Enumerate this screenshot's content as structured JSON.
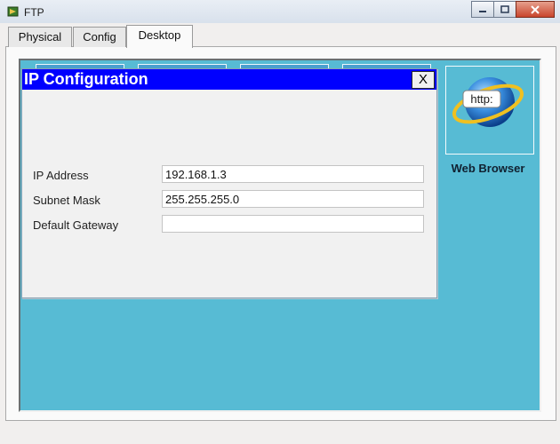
{
  "window": {
    "title": "FTP",
    "minimize_label": "minimize",
    "maximize_label": "maximize",
    "close_label": "close"
  },
  "tabs": [
    {
      "label": "Physical",
      "active": false
    },
    {
      "label": "Config",
      "active": false
    },
    {
      "label": "Desktop",
      "active": true
    }
  ],
  "dialog": {
    "title": "IP Configuration",
    "close_label": "X",
    "fields": [
      {
        "label": "IP Address",
        "value": "192.168.1.3",
        "placeholder": ""
      },
      {
        "label": "Subnet Mask",
        "value": "255.255.255.0",
        "placeholder": ""
      },
      {
        "label": "Default Gateway",
        "value": "",
        "placeholder": ""
      }
    ]
  },
  "desktop_apps": [
    {
      "label": "Web Browser",
      "icon": "web-browser-icon",
      "icon_text": "http:"
    }
  ],
  "colors": {
    "desktop_bg": "#57bbd4",
    "dialog_titlebar": "#0000ff",
    "dialog_title_text": "#ffffff"
  }
}
